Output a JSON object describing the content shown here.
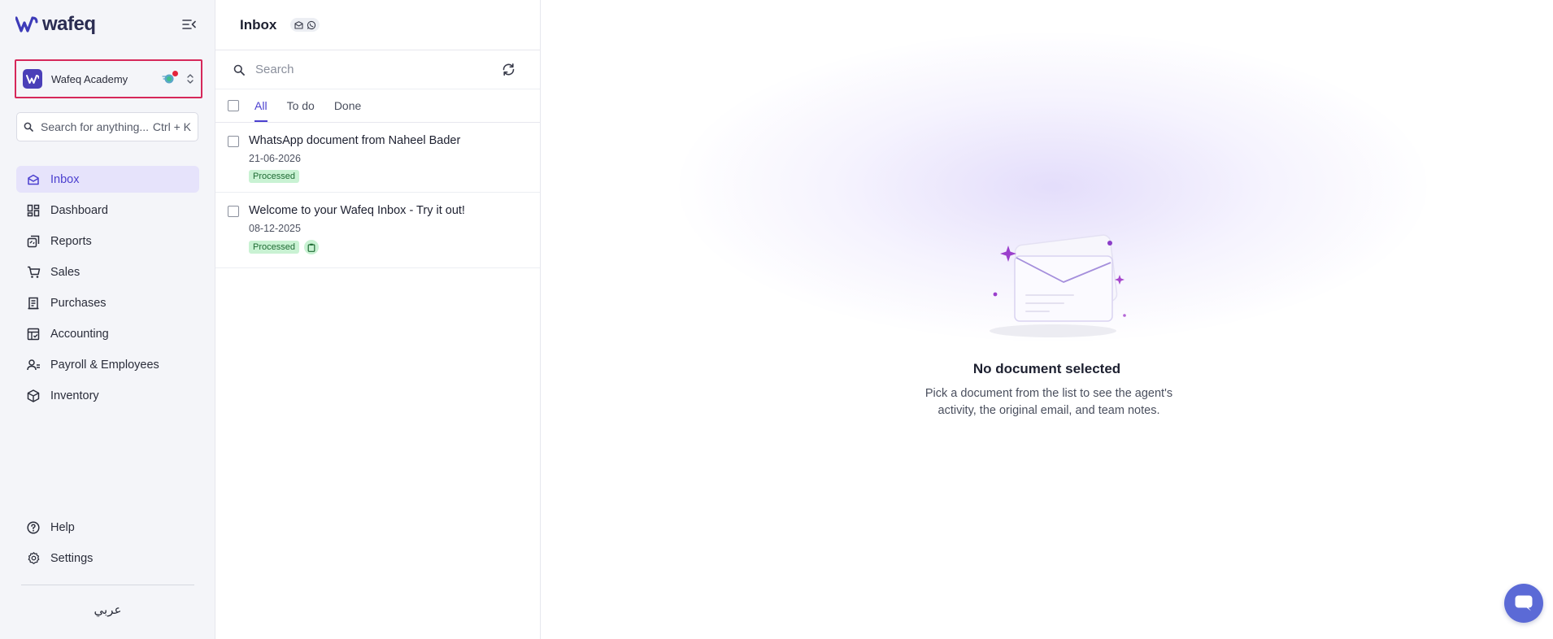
{
  "app": {
    "logo_text": "wafeq"
  },
  "org": {
    "name": "Wafeq Academy"
  },
  "global_search": {
    "placeholder": "Search for anything...",
    "shortcut": "Ctrl + K"
  },
  "nav": {
    "items": [
      {
        "label": "Inbox",
        "icon": "inbox-icon",
        "active": true
      },
      {
        "label": "Dashboard",
        "icon": "dashboard-icon"
      },
      {
        "label": "Reports",
        "icon": "reports-icon"
      },
      {
        "label": "Sales",
        "icon": "cart-icon"
      },
      {
        "label": "Purchases",
        "icon": "receipt-icon"
      },
      {
        "label": "Accounting",
        "icon": "ledger-icon"
      },
      {
        "label": "Payroll & Employees",
        "icon": "people-icon"
      },
      {
        "label": "Inventory",
        "icon": "box-icon"
      }
    ],
    "bottom": [
      {
        "label": "Help",
        "icon": "help-icon"
      },
      {
        "label": "Settings",
        "icon": "gear-icon"
      }
    ],
    "language": "عربي"
  },
  "inbox": {
    "title": "Inbox",
    "search_placeholder": "Search",
    "tabs": [
      "All",
      "To do",
      "Done"
    ],
    "active_tab": "All",
    "items": [
      {
        "title": "WhatsApp document from Naheel Bader",
        "date": "21-06-2026",
        "status": "Processed"
      },
      {
        "title": "Welcome to your Wafeq Inbox - Try it out!",
        "date": "08-12-2025",
        "status": "Processed"
      }
    ]
  },
  "detail": {
    "empty_title": "No document selected",
    "empty_description": "Pick a document from the list to see the agent's activity, the original email, and team notes."
  },
  "colors": {
    "accent": "#4b3fcf",
    "highlight_border": "#d6285a",
    "status_bg": "#c9f2d3",
    "chat_button": "#5b6ad6"
  }
}
